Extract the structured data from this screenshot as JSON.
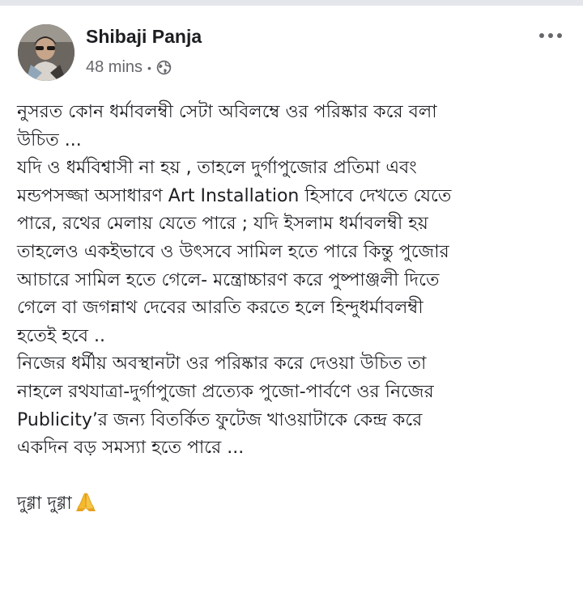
{
  "post": {
    "author_name": "Shibaji Panja",
    "timestamp": "48 mins",
    "separator": "•",
    "audience_icon": "globe-icon",
    "more_icon": "more-options-icon",
    "body_lines": [
      "নুসরত কোন ধর্মাবলম্বী সেটা অবিলম্বে ওর পরিষ্কার করে বলা",
      "উচিত ...",
      "যদি ও ধর্মবিশ্বাসী না হয় , তাহলে দুর্গাপুজোর প্রতিমা এবং",
      "মন্ডপসজ্জা অসাধারণ Art Installation হিসাবে দেখতে যেতে",
      "পারে, রথের মেলায় যেতে পারে ; যদি ইসলাম ধর্মাবলম্বী হয়",
      "তাহলেও একইভাবে ও উৎসবে সামিল হতে পারে কিন্তু পুজোর",
      "আচারে সামিল হতে গেলে- মন্ত্রোচ্চারণ করে পুষ্পাঞ্জলী দিতে",
      "গেলে বা জগন্নাথ দেবের আরতি করতে হলে হিন্দুধর্মাবলম্বী",
      "হতেই হবে ..",
      "নিজের ধর্মীয় অবস্থানটা ওর পরিষ্কার করে দেওয়া উচিত তা",
      "নাহলে রথযাত্রা-দুর্গাপুজো প্রত্যেক পুজো-পার্বণে ওর নিজের",
      "Publicity’র জন্য বিতর্কিত ফুটেজ খাওয়াটাকে কেন্দ্র করে",
      "একদিন বড় সমস্যা হতে পারে ..."
    ],
    "closing_line": "দুগ্গা দুগ্গা",
    "closing_emoji": "folded-hands-icon"
  },
  "colors": {
    "text": "#1c1e21",
    "meta": "#65676b",
    "emoji": "#f5b82e"
  }
}
